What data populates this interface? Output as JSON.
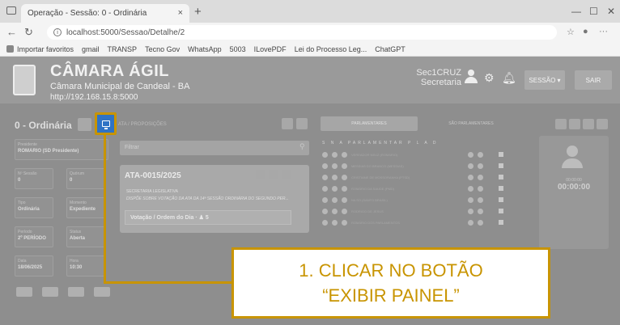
{
  "browser": {
    "tab_title": "Operação - Sessão: 0 - Ordinária",
    "tab_close": "×",
    "new_tab": "+",
    "url": "localhost:5000/Sessao/Detalhe/2",
    "favorites": [
      "Importar favoritos",
      "gmail",
      "TRANSP",
      "Tecno Gov",
      "WhatsApp",
      "5003",
      "ILovePDF",
      "Lei do Processo Leg...",
      "ChatGPT"
    ]
  },
  "header": {
    "brand": "CÂMARA ÁGIL",
    "subtitle": "Câmara Municipal de Candeal - BA",
    "host": "http://192.168.15.8:5000",
    "user_name": "Sec1CRUZ",
    "user_role": "Secretaria",
    "sessao_label": "SESSÃO ▾",
    "sair_label": "SAIR"
  },
  "session": {
    "title": "0 - Ordinária",
    "fields": [
      {
        "label": "Presidente",
        "value": "ROMARIO (SD Presidente)"
      },
      {
        "label": "Nº Sessão",
        "value": "0"
      },
      {
        "label": "Quórum",
        "value": "0"
      },
      {
        "label": "Tipo",
        "value": "Ordinária"
      },
      {
        "label": "Momento",
        "value": "Expediente"
      },
      {
        "label": "Período",
        "value": "2º PERÍODO"
      },
      {
        "label": "Status",
        "value": "Aberta"
      },
      {
        "label": "Data",
        "value": "18/06/2025"
      },
      {
        "label": "Hora",
        "value": "10:30"
      }
    ]
  },
  "middle": {
    "header": "ATA / PROPOSIÇÕES",
    "search_placeholder": "Filtrar",
    "card": {
      "title": "ATA-0015/2025",
      "author": "SECRETARIA LEGISLATIVA",
      "summary": "DISPÕE SOBRE VOTAÇÃO DA ATA DA 14ª SESSÃO ORDINÁRIA DO SEGUNDO PER...",
      "vote_label": "Votação / Ordem do Dia · ♟ 5"
    }
  },
  "right": {
    "tab_active": "PARLAMENTARES",
    "tab_other": "SÃO PARLAMENTARES",
    "header": "S  N  A   PARLAMENTAR                       P  L  A  D",
    "rows": [
      "VEREADOR NEUZ (ROMARIO)",
      "MESSIAS DO BRANCO (MESSIAS)",
      "CRISTIANE DE MOSSORANHA (PTSD)",
      "ROMÁRIO DA SAUDE (PMD)",
      "NILSO (SANTO BRASIL)",
      "RODRIGO DE JESUS",
      "ROMÁRIO DOS PARLAMENTOS"
    ],
    "timer_label": "00:00:00",
    "timer": "00:00:00"
  },
  "annotation": {
    "line1": "1. CLICAR NO BOTÃO",
    "line2": "“EXIBIR PAINEL”"
  }
}
